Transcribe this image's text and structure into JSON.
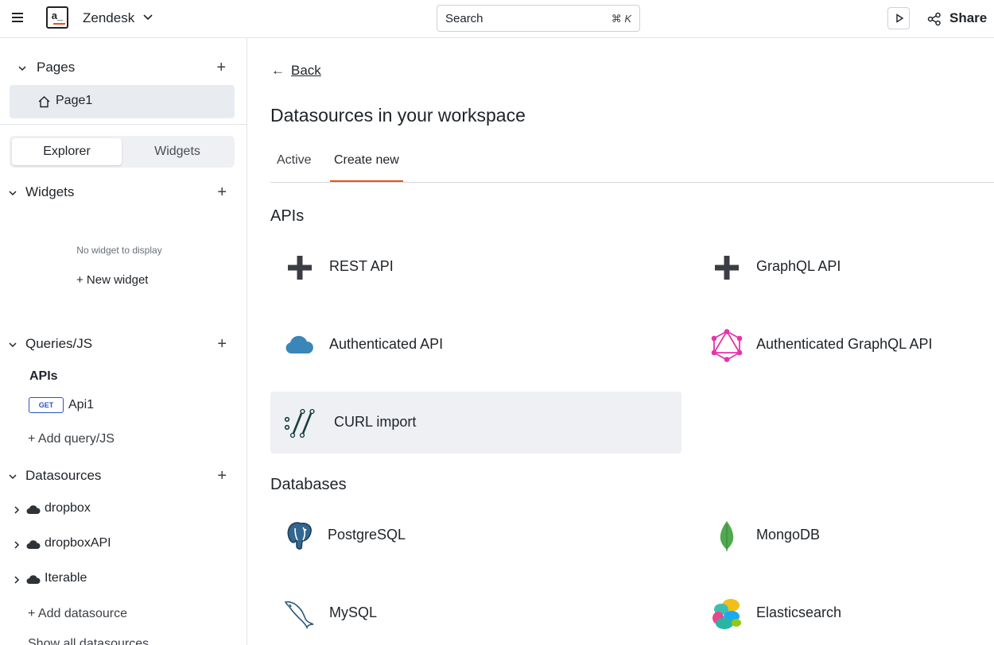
{
  "topbar": {
    "logo_text": "a_",
    "app_name": "Zendesk",
    "search_placeholder": "Search",
    "search_shortcut": "⌘ K",
    "share_label": "Share"
  },
  "sidebar": {
    "pages_title": "Pages",
    "page_item": "Page1",
    "tabs": {
      "explorer": "Explorer",
      "widgets": "Widgets"
    },
    "widgets_title": "Widgets",
    "no_widget_text": "No widget to display",
    "new_widget": "+ New widget",
    "queries_title": "Queries/JS",
    "apis_subhead": "APIs",
    "api_item": {
      "method": "GET",
      "name": "Api1"
    },
    "add_query": "+ Add query/JS",
    "datasources_title": "Datasources",
    "datasources": [
      "dropbox",
      "dropboxAPI",
      "Iterable"
    ],
    "add_datasource": "+ Add datasource",
    "show_all": "Show all datasources"
  },
  "main": {
    "back_arrow": "←",
    "back_label": "Back",
    "heading": "Datasources in your workspace",
    "tabs": {
      "active": "Active",
      "create_new": "Create new"
    },
    "apis_title": "APIs",
    "apis": {
      "rest": {
        "label": "REST API",
        "icon": "plus-icon"
      },
      "graphql": {
        "label": "GraphQL API",
        "icon": "plus-icon"
      },
      "auth": {
        "label": "Authenticated API",
        "icon": "cloud-icon"
      },
      "auth_graphql": {
        "label": "Authenticated GraphQL API",
        "icon": "graphql-icon"
      },
      "curl": {
        "label": "CURL import",
        "icon": "curl-icon"
      }
    },
    "databases_title": "Databases",
    "databases": {
      "postgres": {
        "label": "PostgreSQL",
        "icon": "postgresql-icon"
      },
      "mongo": {
        "label": "MongoDB",
        "icon": "mongodb-icon"
      },
      "mysql": {
        "label": "MySQL",
        "icon": "mysql-icon"
      },
      "elastic": {
        "label": "Elasticsearch",
        "icon": "elasticsearch-icon"
      }
    }
  },
  "colors": {
    "accent": "#e15615",
    "cloud": "#3b86b8",
    "graphql": "#e535ab",
    "mongo": "#4fa94d"
  }
}
